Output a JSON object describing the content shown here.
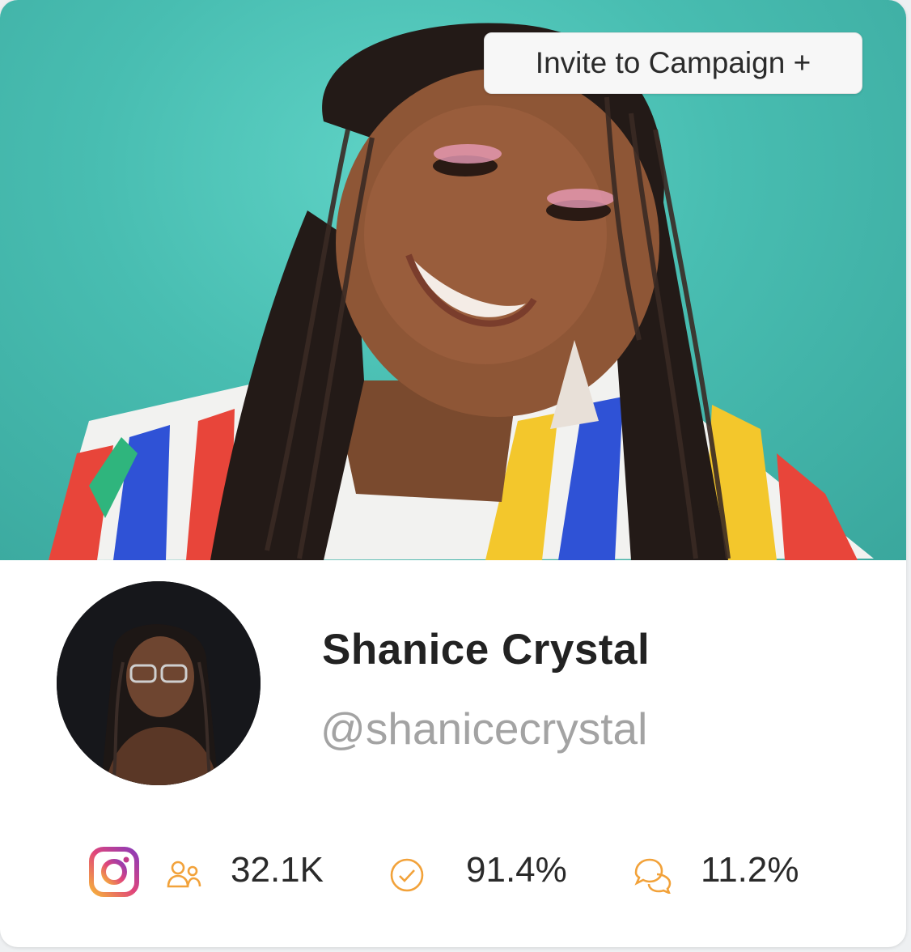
{
  "invite_button": {
    "label": "Invite to Campaign +"
  },
  "profile": {
    "name": "Shanice Crystal",
    "handle": "@shanicecrystal"
  },
  "stats": {
    "platform_icon": "instagram-icon",
    "followers": {
      "icon": "followers-icon",
      "value": "32.1K"
    },
    "authenticity": {
      "icon": "check-circle-icon",
      "value": "91.4%"
    },
    "engagement": {
      "icon": "chat-bubbles-icon",
      "value": "11.2%"
    }
  },
  "colors": {
    "hero_background": "#48bdb1",
    "accent_orange": "#f2a23a",
    "handle_gray": "#a3a3a3"
  }
}
